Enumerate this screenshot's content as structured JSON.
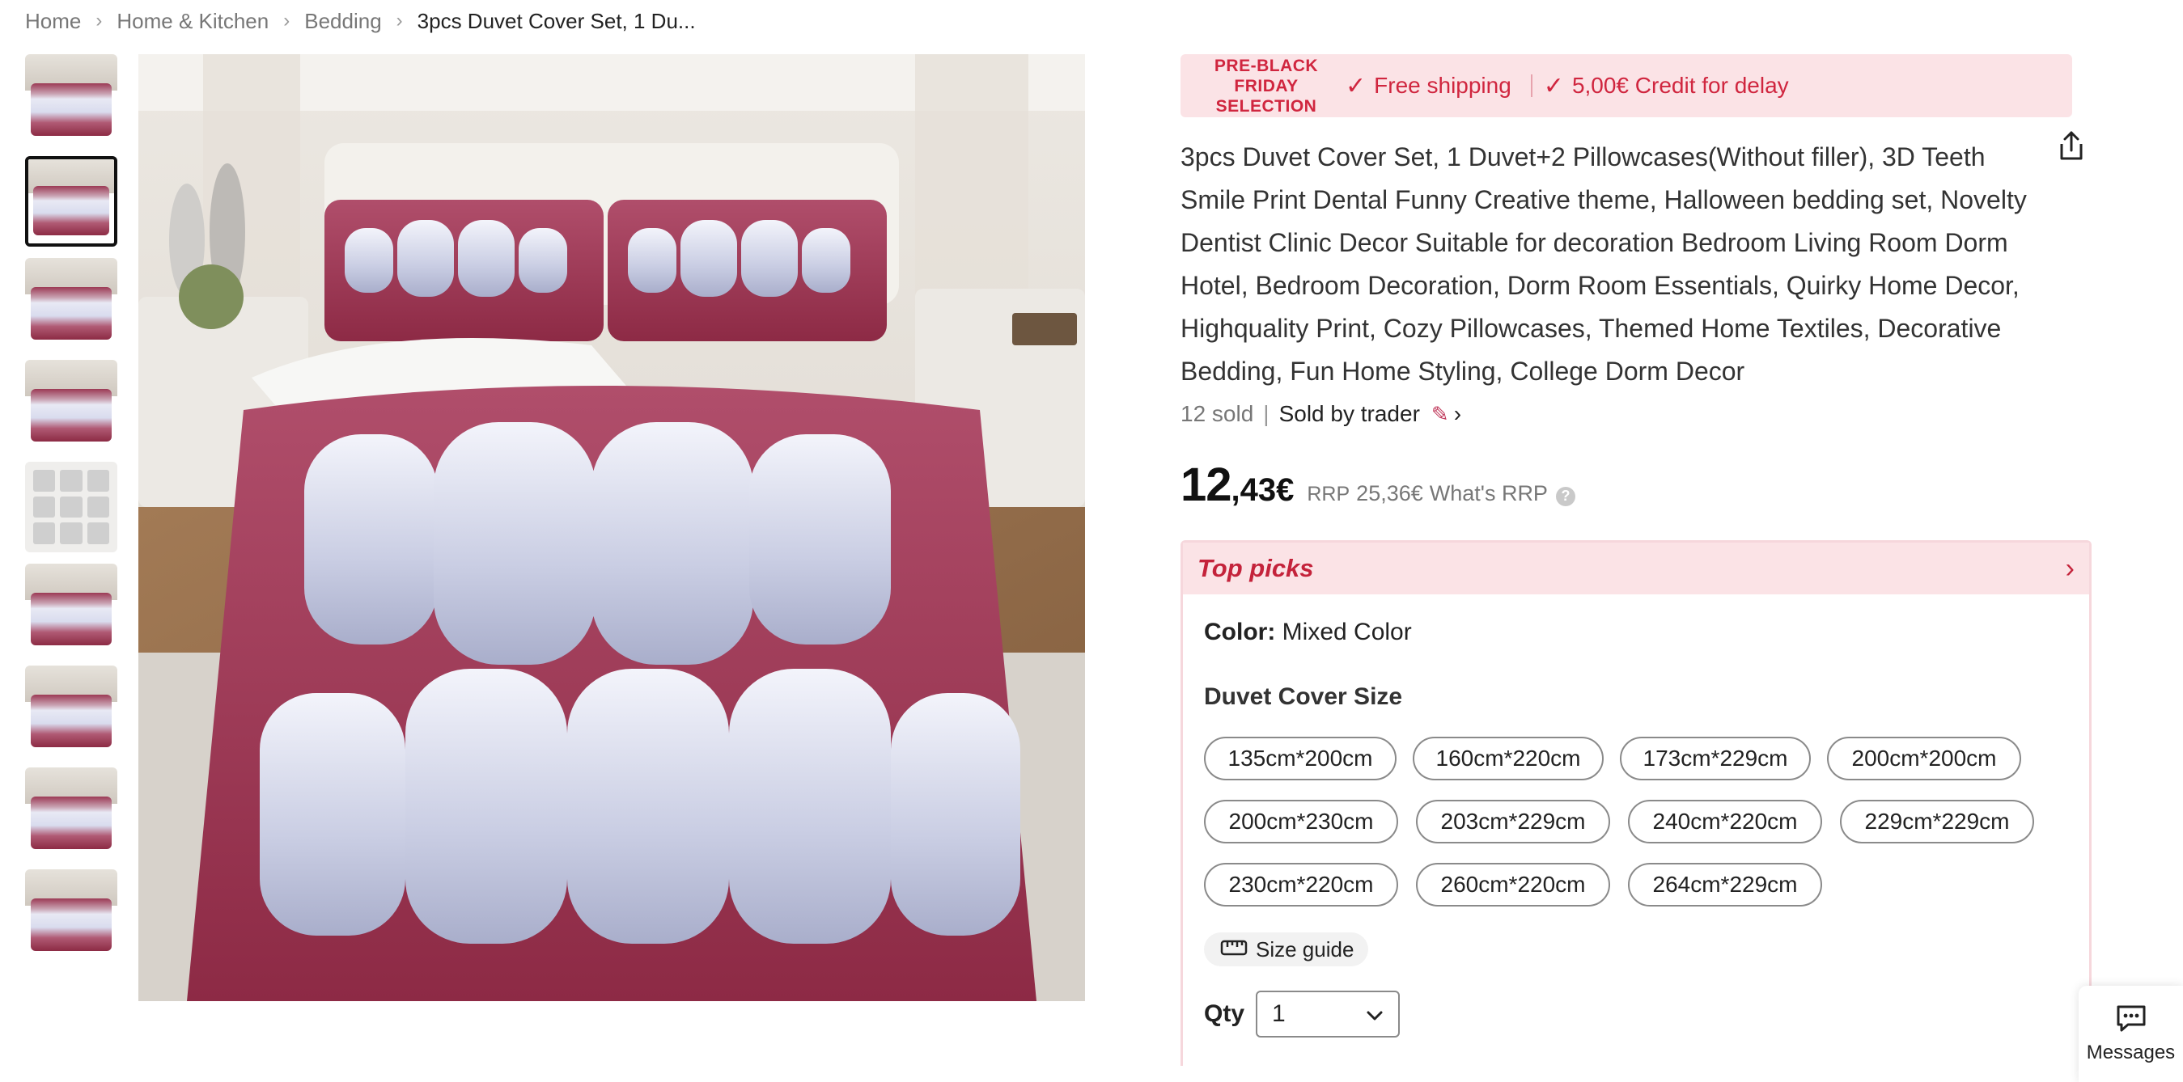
{
  "breadcrumb": {
    "items": [
      "Home",
      "Home & Kitchen",
      "Bedding"
    ],
    "current": "3pcs Duvet Cover Set, 1 Du..."
  },
  "thumbnails": {
    "count": 9,
    "active_index": 1
  },
  "promo": {
    "badge_line1": "PRE-BLACK FRIDAY",
    "badge_line2": "SELECTION",
    "free_shipping": "Free shipping",
    "credit": "5,00€ Credit for delay"
  },
  "product": {
    "title": "3pcs Duvet Cover Set, 1 Duvet+2 Pillowcases(Without filler), 3D Teeth Smile Print Dental Funny Creative theme, Halloween bedding set, Novelty Dentist Clinic Decor Suitable for decoration Bedroom Living Room Dorm Hotel, Bedroom Decoration, Dorm Room Essentials, Quirky Home Decor, Highquality Print, Cozy Pillowcases, Themed Home Textiles, Decorative Bedding, Fun Home Styling, College Dorm Decor",
    "sold": "12 sold",
    "sold_by": "Sold by trader",
    "price_int": "12",
    "price_dec": ",43€",
    "rrp_label": "RRP",
    "rrp_value": "25,36€",
    "whats_rrp": "What's RRP"
  },
  "top_picks": {
    "title": "Top picks",
    "color_label": "Color:",
    "color_value": "Mixed Color",
    "size_label": "Duvet Cover Size",
    "sizes": [
      "135cm*200cm",
      "160cm*220cm",
      "173cm*229cm",
      "200cm*200cm",
      "200cm*230cm",
      "203cm*229cm",
      "240cm*220cm",
      "229cm*229cm",
      "230cm*220cm",
      "260cm*220cm",
      "264cm*229cm"
    ],
    "size_guide": "Size guide",
    "qty_label": "Qty",
    "qty_value": "1"
  },
  "messages": {
    "label": "Messages"
  },
  "colors": {
    "accent": "#d0263f",
    "promo_bg": "#fbe3e6"
  }
}
